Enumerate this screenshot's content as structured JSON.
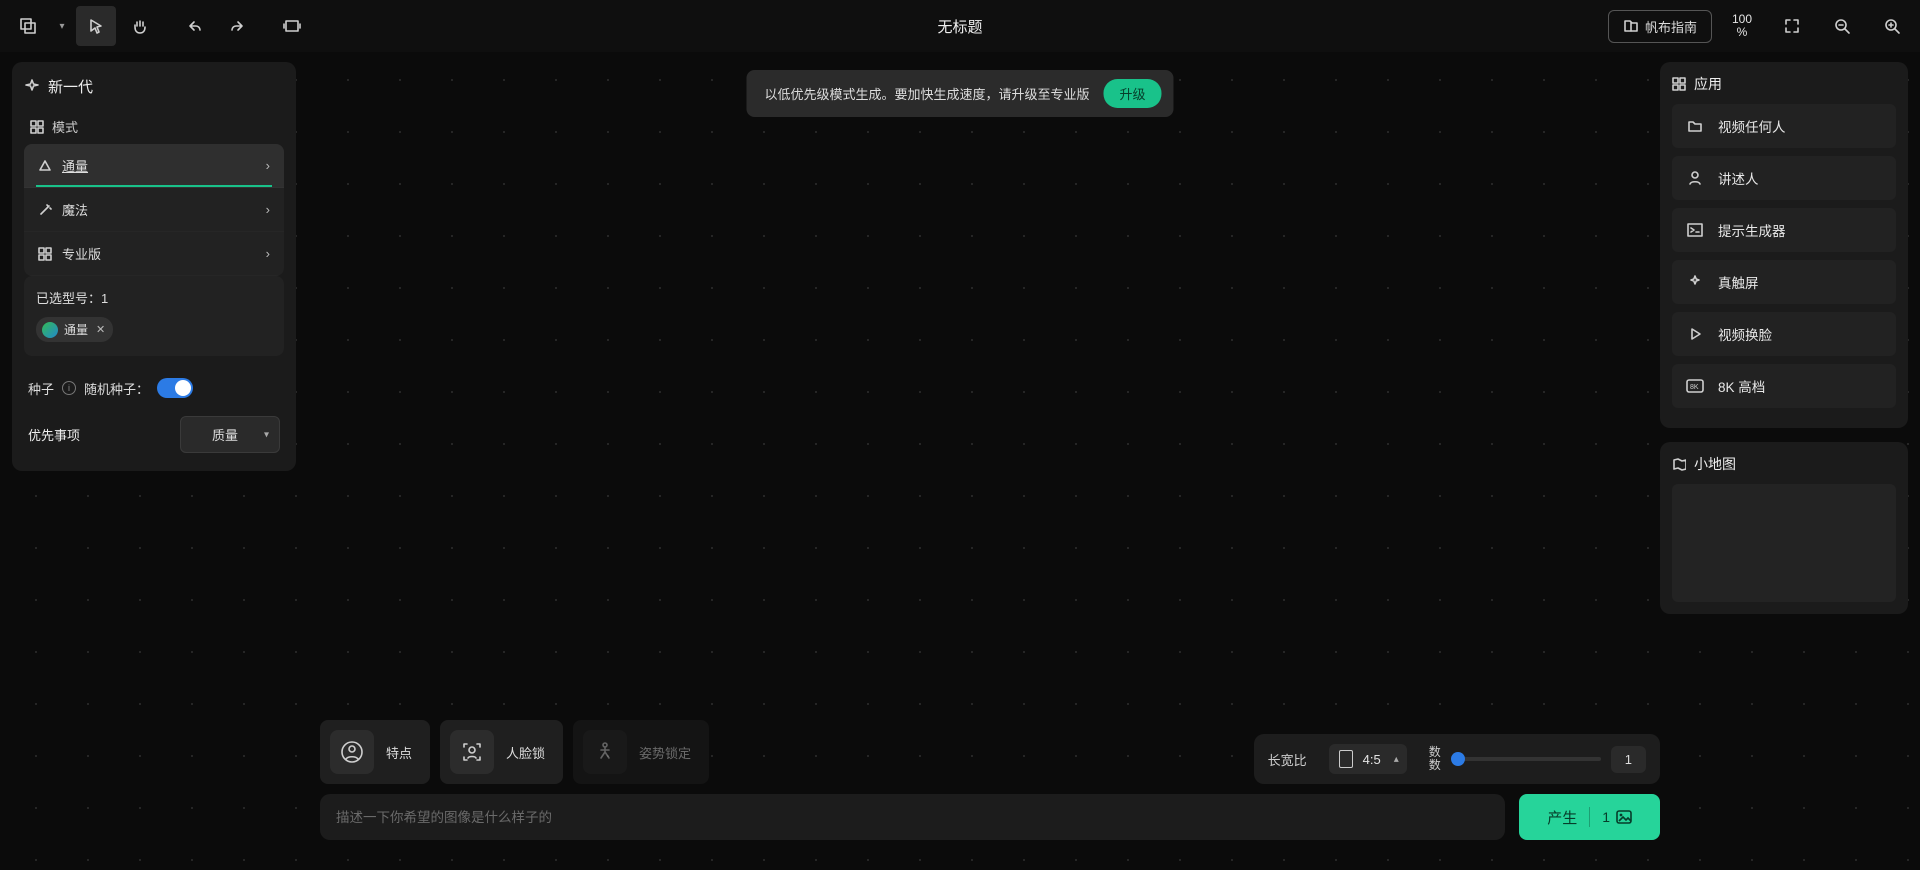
{
  "topbar": {
    "title": "无标题",
    "guide_label": "帆布指南",
    "zoom_value": "100",
    "zoom_unit": "%"
  },
  "notice": {
    "text": "以低优先级模式生成。要加快生成速度，请升级至专业版",
    "upgrade_label": "升级"
  },
  "left": {
    "title": "新一代",
    "modes_header": "模式",
    "modes": [
      {
        "label": "通量",
        "active": true
      },
      {
        "label": "魔法",
        "active": false
      },
      {
        "label": "专业版",
        "active": false
      }
    ],
    "selected_header": "已选型号：1",
    "selected_chip": "通量",
    "seed_label": "种子",
    "random_seed_label": "随机种子：",
    "priority_label": "优先事项",
    "priority_value": "质量"
  },
  "right": {
    "apps_title": "应用",
    "apps": [
      {
        "label": "视频任何人",
        "icon": "folder"
      },
      {
        "label": "讲述人",
        "icon": "person"
      },
      {
        "label": "提示生成器",
        "icon": "terminal"
      },
      {
        "label": "真触屏",
        "icon": "sparkle"
      },
      {
        "label": "视频换脸",
        "icon": "play"
      },
      {
        "label": "8K 高档",
        "icon": "eightk"
      }
    ],
    "minimap_title": "小地图"
  },
  "features": {
    "f0": "特点",
    "f1": "人脸锁",
    "f2": "姿势锁定"
  },
  "prompt": {
    "placeholder": "描述一下你希望的图像是什么样子的"
  },
  "controls": {
    "aspect_label": "长宽比",
    "aspect_value": "4:5",
    "count_label_a": "数",
    "count_label_b": "数",
    "count_value": "1"
  },
  "generate": {
    "label": "产生",
    "count": "1"
  }
}
